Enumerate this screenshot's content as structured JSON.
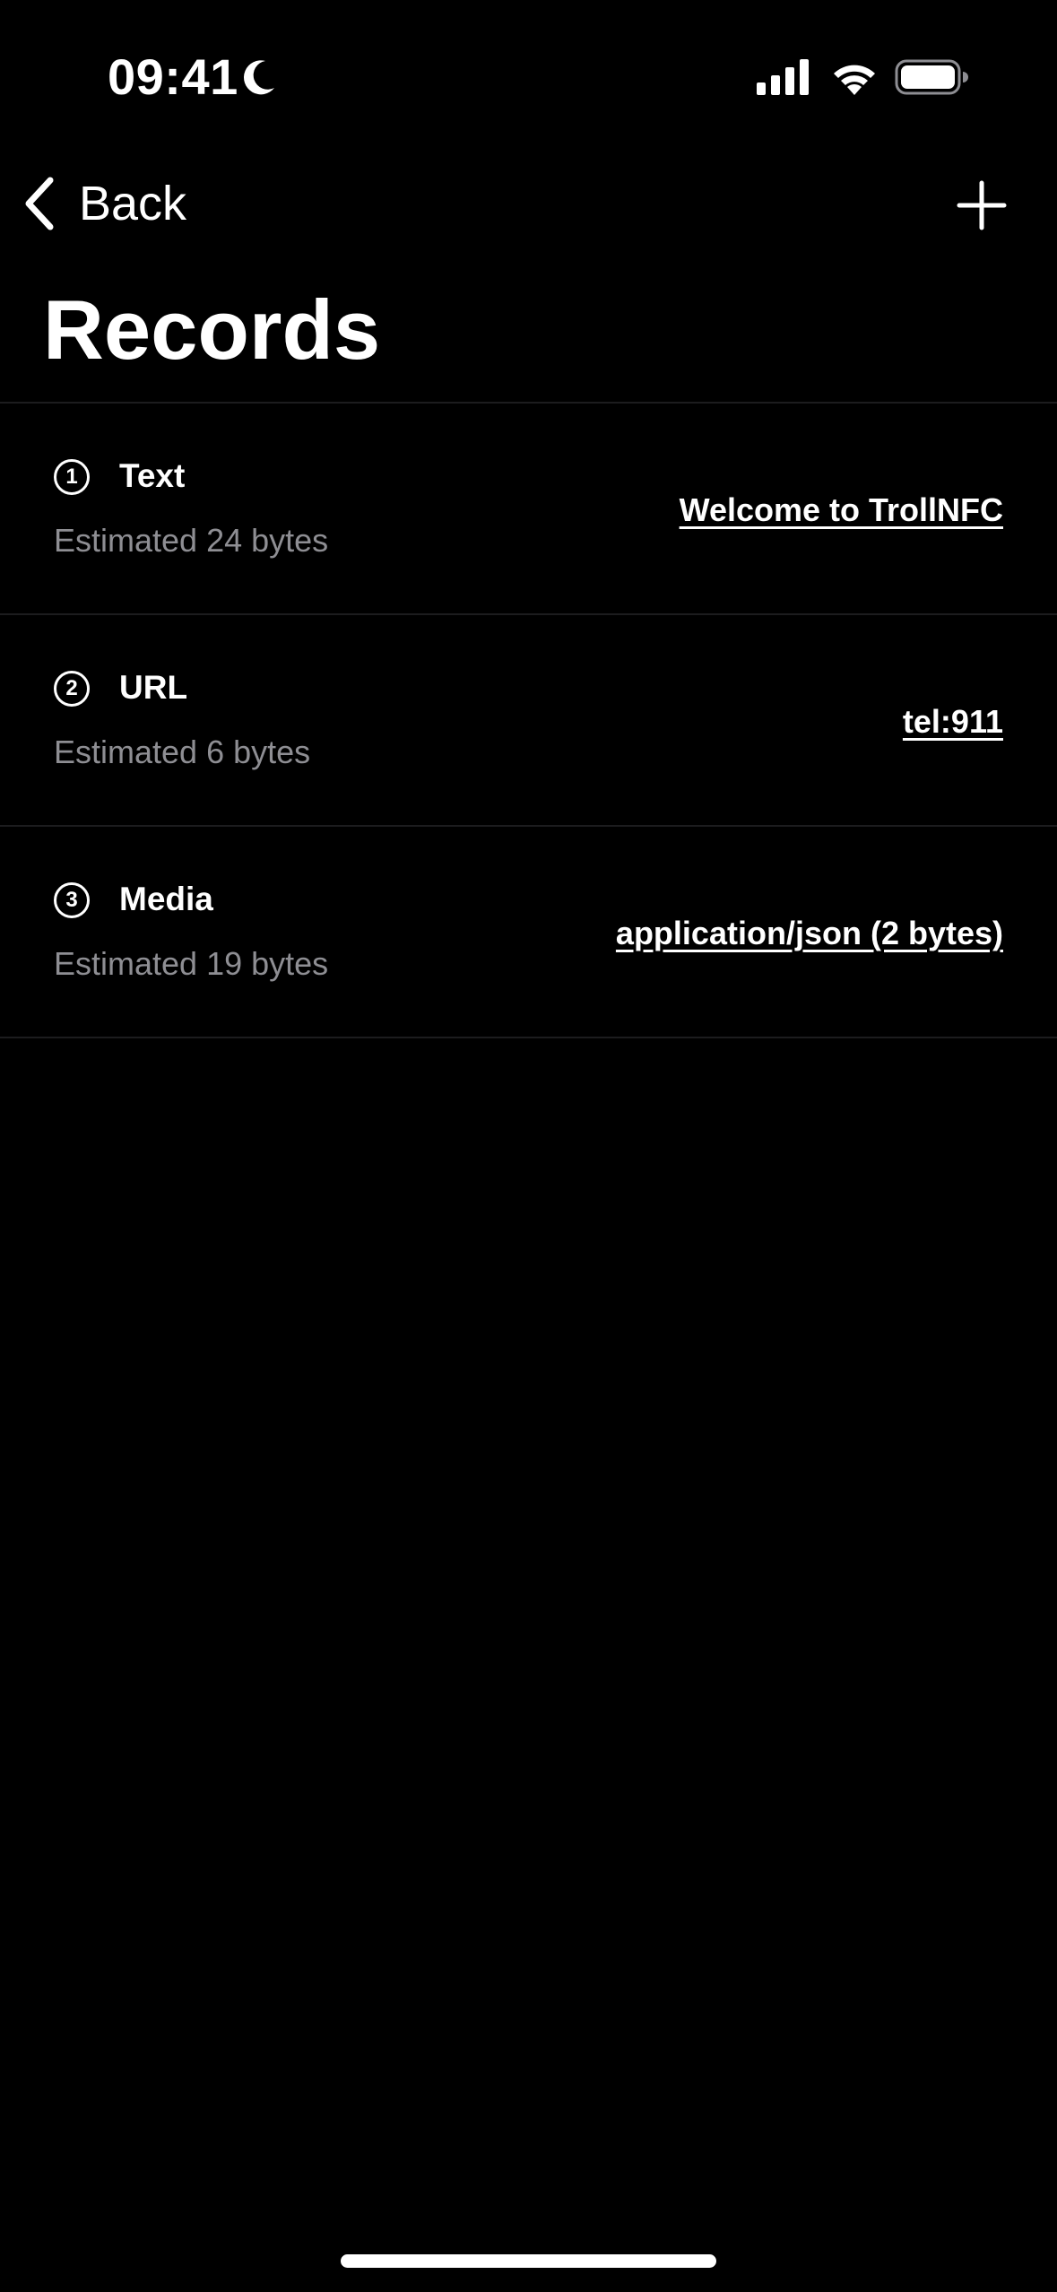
{
  "status_bar": {
    "time": "09:41",
    "focus_icon": "moon-icon",
    "signal_icon": "cellular-signal-icon",
    "wifi_icon": "wifi-icon",
    "battery_icon": "battery-icon",
    "battery_level": 1.0
  },
  "nav": {
    "back_label": "Back",
    "back_icon": "chevron-left-icon",
    "add_icon": "plus-icon"
  },
  "page": {
    "title": "Records"
  },
  "records": [
    {
      "number": "1",
      "type": "Text",
      "size": "Estimated 24 bytes",
      "value": "Welcome to TrollNFC"
    },
    {
      "number": "2",
      "type": "URL",
      "size": "Estimated 6 bytes",
      "value": "tel:911"
    },
    {
      "number": "3",
      "type": "Media",
      "size": "Estimated 19 bytes",
      "value": "application/json (2 bytes)"
    }
  ],
  "colors": {
    "background": "#000000",
    "text_primary": "#ffffff",
    "text_secondary": "#8e8e93",
    "separator": "#1c1c1e"
  }
}
